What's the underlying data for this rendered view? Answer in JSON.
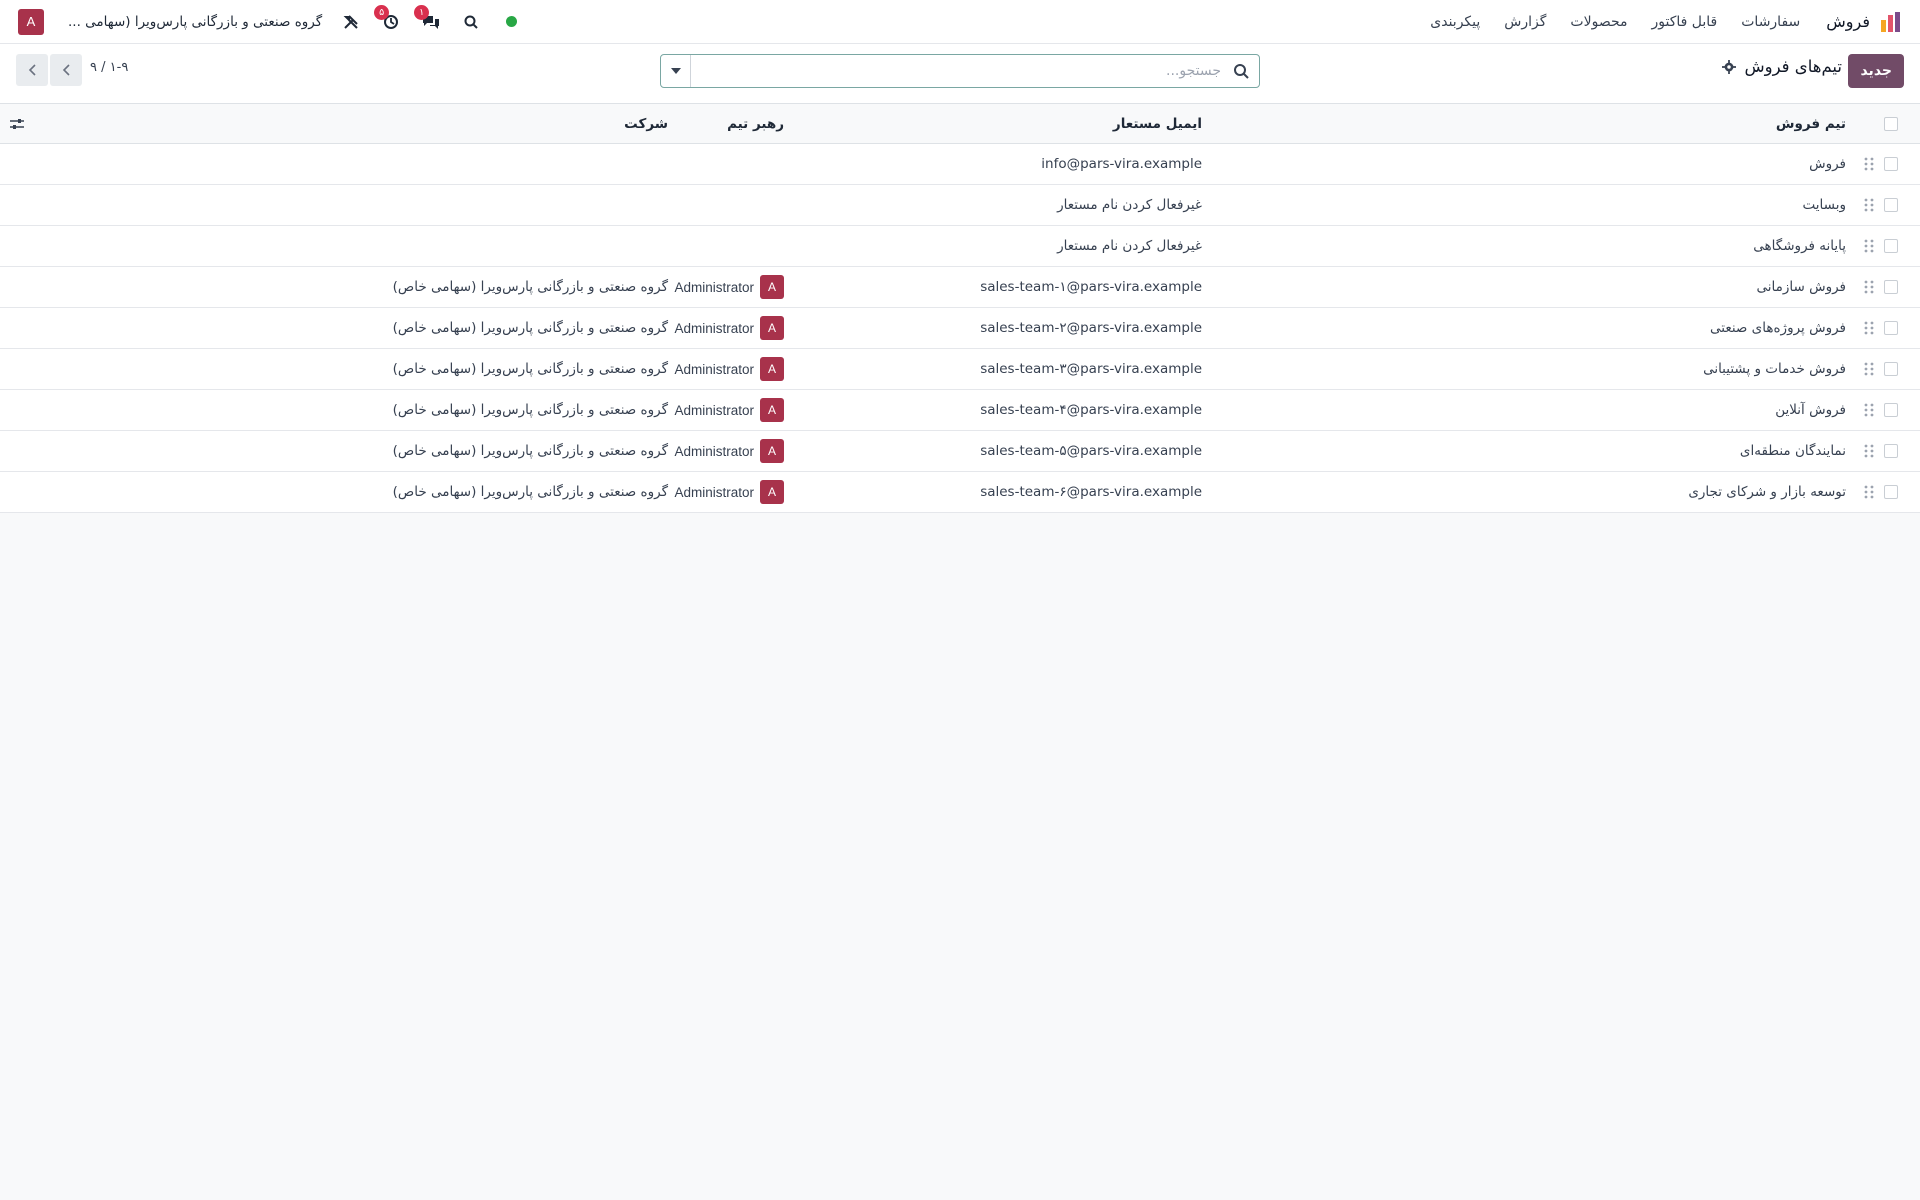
{
  "navbar": {
    "app_name": "فروش",
    "menu": [
      {
        "label": "سفارشات"
      },
      {
        "label": "قابل فاکتور"
      },
      {
        "label": "محصولات"
      },
      {
        "label": "گزارش"
      },
      {
        "label": "پیکربندی"
      }
    ],
    "company": "گروه صنعتی و بازرگانی پارس‌ویرا (سهامی ...",
    "user_initial": "A",
    "activity_count": "۵",
    "messages_count": "۱",
    "status_color": "#28a745"
  },
  "control_panel": {
    "new_button": "جدید",
    "breadcrumb": "تیم‌های فروش",
    "search_placeholder": "جستجو...",
    "pager": "۱-۹ / ۹"
  },
  "table": {
    "headers": {
      "team": "تیم فروش",
      "email": "ایمیل مستعار",
      "leader": "رهبر تیم",
      "company": "شرکت"
    },
    "rows": [
      {
        "team": "فروش",
        "email": "info@pars-vira.example",
        "leader": "",
        "leader_initial": "",
        "company": ""
      },
      {
        "team": "وبسایت",
        "email": "غیرفعال کردن نام مستعار",
        "leader": "",
        "leader_initial": "",
        "company": ""
      },
      {
        "team": "پایانه فروشگاهی",
        "email": "غیرفعال کردن نام مستعار",
        "leader": "",
        "leader_initial": "",
        "company": ""
      },
      {
        "team": "فروش سازمانی",
        "email": "sales-team-۱@pars-vira.example",
        "leader": "Administrator",
        "leader_initial": "A",
        "company": "گروه صنعتی و بازرگانی پارس‌ویرا (سهامی خاص)"
      },
      {
        "team": "فروش پروژه‌های صنعتی",
        "email": "sales-team-۲@pars-vira.example",
        "leader": "Administrator",
        "leader_initial": "A",
        "company": "گروه صنعتی و بازرگانی پارس‌ویرا (سهامی خاص)"
      },
      {
        "team": "فروش خدمات و پشتیبانی",
        "email": "sales-team-۳@pars-vira.example",
        "leader": "Administrator",
        "leader_initial": "A",
        "company": "گروه صنعتی و بازرگانی پارس‌ویرا (سهامی خاص)"
      },
      {
        "team": "فروش آنلاین",
        "email": "sales-team-۴@pars-vira.example",
        "leader": "Administrator",
        "leader_initial": "A",
        "company": "گروه صنعتی و بازرگانی پارس‌ویرا (سهامی خاص)"
      },
      {
        "team": "نمایندگان منطقه‌ای",
        "email": "sales-team-۵@pars-vira.example",
        "leader": "Administrator",
        "leader_initial": "A",
        "company": "گروه صنعتی و بازرگانی پارس‌ویرا (سهامی خاص)"
      },
      {
        "team": "توسعه بازار و شرکای تجاری",
        "email": "sales-team-۶@pars-vira.example",
        "leader": "Administrator",
        "leader_initial": "A",
        "company": "گروه صنعتی و بازرگانی پارس‌ویرا (سهامی خاص)"
      }
    ]
  }
}
